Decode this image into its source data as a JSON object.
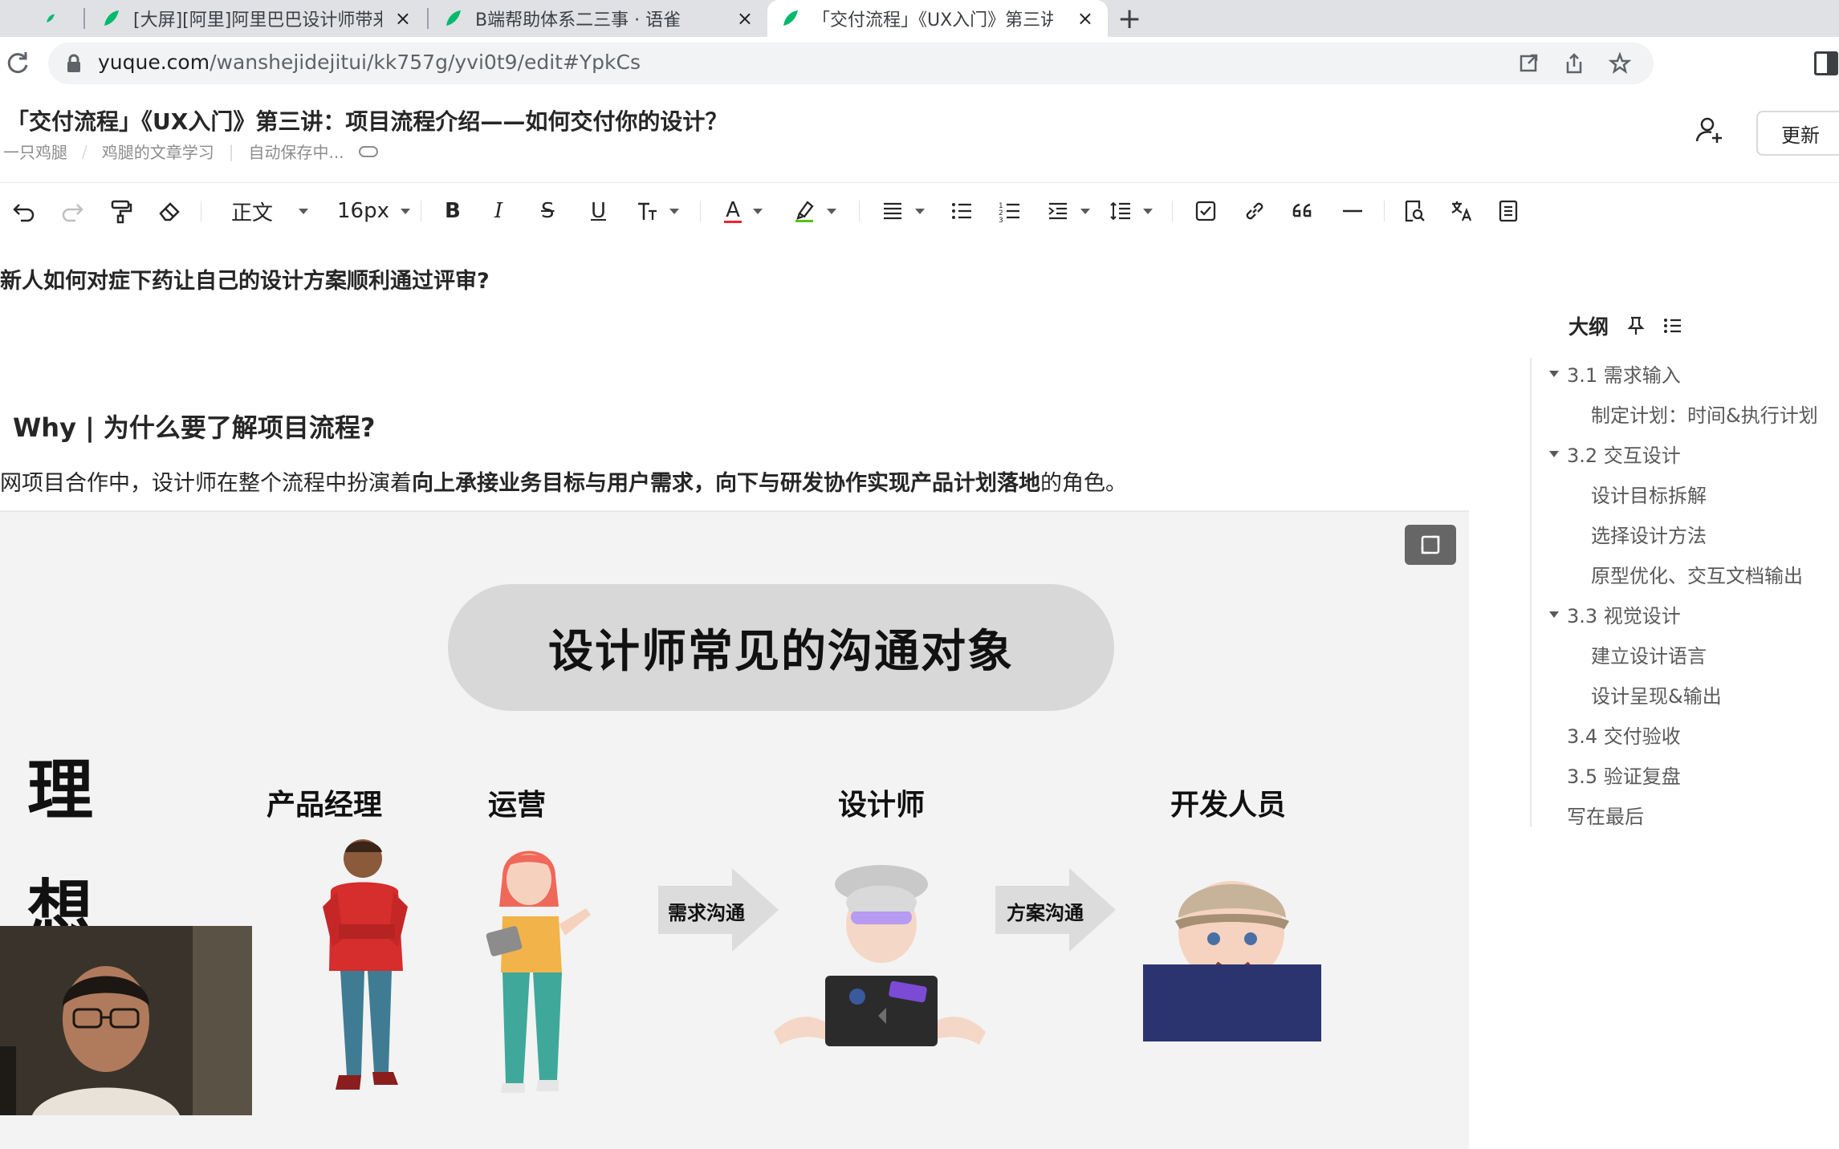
{
  "browser": {
    "tabs": [
      {
        "label": "[大屏][阿里]阿里巴巴设计师带来",
        "active": false
      },
      {
        "label": "B端帮助体系二三事 · 语雀",
        "active": false
      },
      {
        "label": "「交付流程」《UX入门》第三讲",
        "active": true
      }
    ],
    "new_tab": "+",
    "close_glyph": "×",
    "url_host": "yuque.com",
    "url_path": "/wanshejidejitui/kk757g/yvi0t9/edit#YpkCs"
  },
  "doc": {
    "title": "「交付流程」《UX入门》第三讲：项目流程介绍——如何交付你的设计？",
    "author": "一只鸡腿",
    "book": "鸡腿的文章学习",
    "status": "自动保存中...",
    "update_label": "更新"
  },
  "toolbar": {
    "paragraph_style": "正文",
    "font_size": "16px",
    "bold": "B",
    "italic": "I",
    "strike": "S",
    "underline": "U",
    "font_color": "A"
  },
  "content": {
    "sub_heading": "新人如何对症下药让自己的设计方案顺利通过评审?",
    "h2": "Why | 为什么要了解项目流程?",
    "para_prefix": "网项目合作中，设计师在整个流程中扮演着",
    "para_bold": "向上承接业务目标与用户需求，向下与研发协作实现产品计划落地",
    "para_suffix": "的角色。"
  },
  "figure": {
    "title": "设计师常见的沟通对象",
    "left_chars": [
      "理",
      "想"
    ],
    "roles": [
      "产品经理",
      "运营",
      "设计师",
      "开发人员"
    ],
    "arrows": [
      "需求沟通",
      "方案沟通"
    ]
  },
  "outline": {
    "title": "大纲",
    "items": [
      {
        "label": "3.1 需求输入",
        "level": 1,
        "collapsible": true
      },
      {
        "label": "制定计划：时间&执行计划",
        "level": 2,
        "collapsible": false
      },
      {
        "label": "3.2 交互设计",
        "level": 1,
        "collapsible": true
      },
      {
        "label": "设计目标拆解",
        "level": 2,
        "collapsible": false
      },
      {
        "label": "选择设计方法",
        "level": 2,
        "collapsible": false
      },
      {
        "label": "原型优化、交互文档输出",
        "level": 2,
        "collapsible": false
      },
      {
        "label": "3.3 视觉设计",
        "level": 1,
        "collapsible": true
      },
      {
        "label": "建立设计语言",
        "level": 2,
        "collapsible": false
      },
      {
        "label": "设计呈现&输出",
        "level": 2,
        "collapsible": false
      },
      {
        "label": "3.4 交付验收",
        "level": 1,
        "collapsible": false
      },
      {
        "label": "3.5 验证复盘",
        "level": 1,
        "collapsible": false
      },
      {
        "label": "写在最后",
        "level": 1,
        "collapsible": false
      }
    ]
  },
  "colors": {
    "brand": "#00b96b",
    "chrome": "#dfe1e5",
    "font_color_underline": "#f5222d"
  }
}
